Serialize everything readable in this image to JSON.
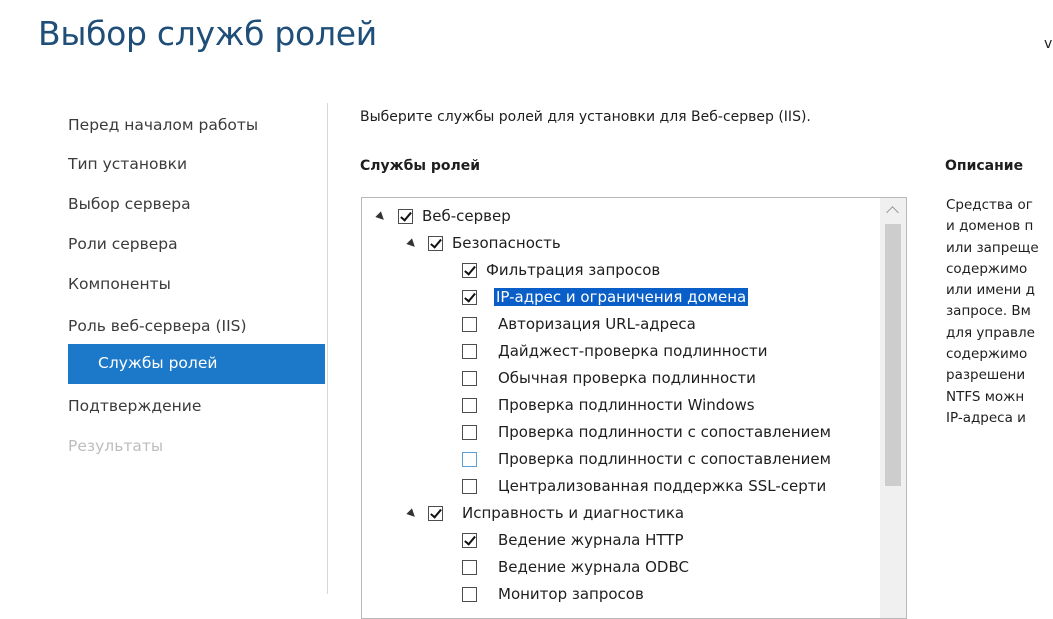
{
  "page": {
    "title": "Выбор служб ролей",
    "server_corner": "v"
  },
  "nav": {
    "items": [
      {
        "label": "Перед началом работы",
        "state": "normal"
      },
      {
        "label": "Тип установки",
        "state": "normal"
      },
      {
        "label": "Выбор сервера",
        "state": "normal"
      },
      {
        "label": "Роли сервера",
        "state": "normal"
      },
      {
        "label": "Компоненты",
        "state": "normal"
      },
      {
        "label": "Роль веб-сервера (IIS)",
        "state": "normal"
      },
      {
        "label": "Службы ролей",
        "state": "selected"
      },
      {
        "label": "Подтверждение",
        "state": "normal"
      },
      {
        "label": "Результаты",
        "state": "disabled"
      }
    ]
  },
  "main": {
    "instruction": "Выберите службы ролей для установки для Веб-сервер (IIS).",
    "role_services_header": "Службы ролей",
    "description_header": "Описание",
    "tree": [
      {
        "label": "Веб-сервер",
        "level": 0,
        "checked": true,
        "expandable": true
      },
      {
        "label": "Безопасность",
        "level": 1,
        "checked": true,
        "expandable": true
      },
      {
        "label": "Фильтрация запросов",
        "level": 2,
        "checked": true
      },
      {
        "label": "IP-адрес и ограничения домена",
        "level": 2,
        "checked": true,
        "selected": true
      },
      {
        "label": "Авторизация URL-адреса",
        "level": 2,
        "checked": false
      },
      {
        "label": "Дайджест-проверка подлинности",
        "level": 2,
        "checked": false
      },
      {
        "label": "Обычная проверка подлинности",
        "level": 2,
        "checked": false
      },
      {
        "label": "Проверка подлинности Windows",
        "level": 2,
        "checked": false
      },
      {
        "label": "Проверка подлинности с сопоставлением",
        "level": 2,
        "checked": false
      },
      {
        "label": "Проверка подлинности с сопоставлением",
        "level": 2,
        "checked": false,
        "hover": true
      },
      {
        "label": "Централизованная поддержка SSL-серти",
        "level": 2,
        "checked": false
      },
      {
        "label": "Исправность и диагностика",
        "level": 1,
        "checked": true,
        "expandable": true
      },
      {
        "label": "Ведение журнала HTTP",
        "level": 2,
        "checked": true
      },
      {
        "label": "Ведение журнала ODBC",
        "level": 2,
        "checked": false
      },
      {
        "label": "Монитор запросов",
        "level": 2,
        "checked": false
      }
    ],
    "description_lines": [
      "Средства ог",
      "и доменов п",
      "или запреще",
      "содержимо",
      "или имени д",
      "запросе. Вм",
      "для управле",
      "содержимо",
      "разрешени",
      "NTFS можн",
      "IP-адреса и"
    ]
  },
  "colors": {
    "title": "#1f4e79",
    "nav_selected_bg": "#1c79c9",
    "tree_highlight": "#0a5ec8"
  }
}
